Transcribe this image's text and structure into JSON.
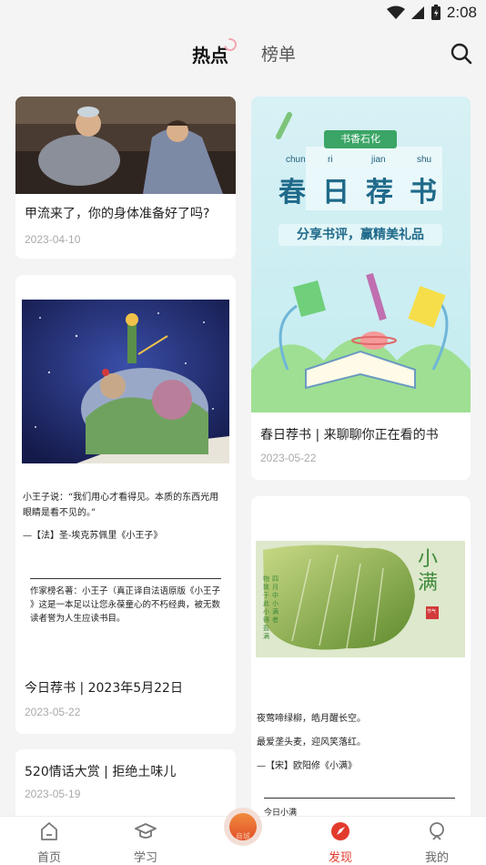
{
  "status": {
    "time": "2:08"
  },
  "tabs": [
    {
      "label": "热点"
    },
    {
      "label": "榜单"
    }
  ],
  "left_column": [
    {
      "title": "甲流来了，你的身体准备好了吗?",
      "date": "2023-04-10"
    },
    {
      "quote_lines": [
        "小王子说：“我们用心才看得见。本质的东西光用",
        "眼睛是看不见的。”"
      ],
      "quote_source": "—【法】圣-埃克苏佩里《小王子》",
      "note_lines": [
        "作家榜名著：小王子（真正译自法语原版《小王子",
        "》这是一本足以让您永葆童心的不朽经典，被无数",
        "读者誉为人生应读书目。"
      ],
      "title": "今日荐书 | 2023年5月22日",
      "date": "2023-05-22"
    },
    {
      "title": "520情话大赏 | 拒绝土味儿",
      "date": "2023-05-19"
    }
  ],
  "right_column": [
    {
      "poster": {
        "badge": "书香石化",
        "pinyin": [
          "chun",
          "ri",
          "jian",
          "shu"
        ],
        "chars": [
          "春",
          "日",
          "荐",
          "书"
        ],
        "slogan": "分享书评，赢精美礼品"
      },
      "title": "春日荐书 | 来聊聊你正在看的书",
      "date": "2023-05-22"
    },
    {
      "poster": {
        "big_text": "小满",
        "seal": "节气",
        "vertical_lines": [
          "物致于此小得盈满",
          "四月中小满者"
        ]
      },
      "poem_lines": [
        "夜莺啼绿柳，皓月醒长空。",
        "最爱垄头麦，迎风笑落红。"
      ],
      "poem_source": "—【宋】欧阳修《小满》",
      "title_partial": "今日小满"
    }
  ],
  "bottom_nav": {
    "items": [
      {
        "label": "首页"
      },
      {
        "label": "学习"
      },
      {
        "label": "发现"
      },
      {
        "label": "我的"
      }
    ],
    "center_label": "商城"
  },
  "colors": {
    "accent": "#e23b2e",
    "background": "#f4f4f4"
  }
}
